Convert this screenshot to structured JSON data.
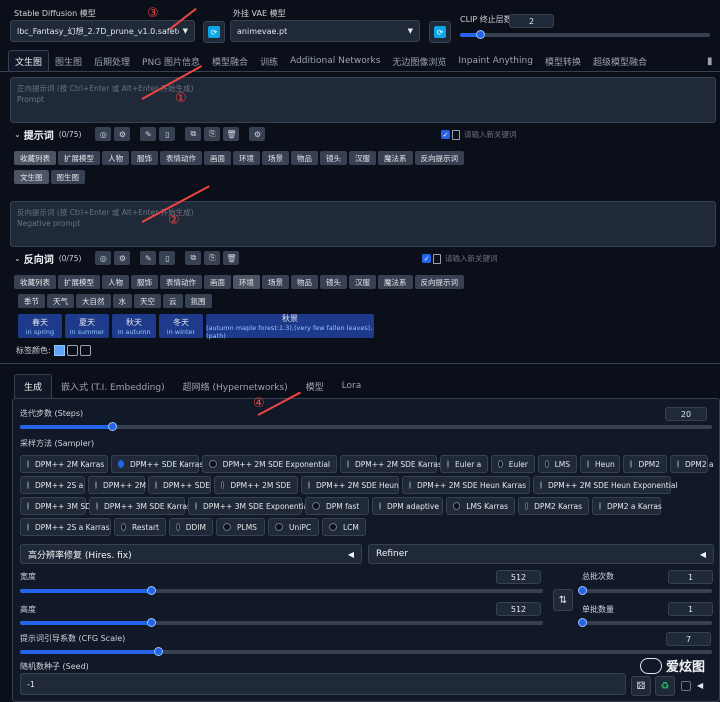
{
  "header": {
    "sd_model_label": "Stable Diffusion 模型",
    "sd_model_value": "lbc_Fantasy_幻想_2.7D_prune_v1.0.safetensors",
    "vae_label": "外挂 VAE 模型",
    "vae_value": "animevae.pt",
    "clip_label": "CLIP 终止层数",
    "clip_value": "2",
    "clip_fraction": 0.08
  },
  "main_tabs": [
    "文生图",
    "图生图",
    "后期处理",
    "PNG 图片信息",
    "模型融合",
    "训练",
    "Additional Networks",
    "无边图像浏览",
    "Inpaint Anything",
    "模型转换",
    "超级模型融合"
  ],
  "prompt": {
    "placeholder_cn": "正向提示词 (按 Ctrl+Enter 或 Alt+Enter 开始生成)",
    "placeholder_en": "Prompt",
    "title": "提示词",
    "count": "(0/75)",
    "new_keyword_placeholder": "请输入新关键词"
  },
  "prompt_cats": [
    "收藏列表",
    "扩展模型",
    "人物",
    "服饰",
    "表情动作",
    "画面",
    "环境",
    "场景",
    "物品",
    "镜头",
    "汉服",
    "魔法系",
    "反向提示词"
  ],
  "prompt_sub": [
    "文生图",
    "图生图"
  ],
  "neg": {
    "placeholder_cn": "反向提示词 (按 Ctrl+Enter 或 Alt+Enter 开始生成)",
    "placeholder_en": "Negative prompt",
    "title": "反向词",
    "count": "(0/75)",
    "new_keyword_placeholder": "请输入新关键词"
  },
  "neg_cats": [
    "收藏列表",
    "扩展模型",
    "人物",
    "服饰",
    "表情动作",
    "画面",
    "环境",
    "场景",
    "物品",
    "镜头",
    "汉服",
    "魔法系",
    "反向提示词"
  ],
  "env_sub": [
    "季节",
    "天气",
    "大自然",
    "水",
    "天空",
    "云",
    "氛围"
  ],
  "seasons": [
    {
      "t": "春天",
      "s": "in spring"
    },
    {
      "t": "夏天",
      "s": "in summer"
    },
    {
      "t": "秋天",
      "s": "in autumn"
    },
    {
      "t": "冬天",
      "s": "in winter"
    },
    {
      "t": "秋景",
      "s": "(autumn maple forest:1.3),(very few fallen leaves),(path)"
    }
  ],
  "tag_color_label": "标签颜色:",
  "gen_tabs": [
    "生成",
    "嵌入式 (T.I. Embedding)",
    "超网络 (Hypernetworks)",
    "模型",
    "Lora"
  ],
  "steps": {
    "label": "迭代步数 (Steps)",
    "value": "20",
    "fraction": 0.133
  },
  "sampler": {
    "label": "采样方法 (Sampler)",
    "rows": [
      [
        "DPM++ 2M Karras",
        "DPM++ SDE Karras",
        "DPM++ 2M SDE Exponential",
        "DPM++ 2M SDE Karras",
        "Euler a",
        "Euler",
        "LMS",
        "Heun",
        "DPM2",
        "DPM2 a"
      ],
      [
        "DPM++ 2S a",
        "DPM++ 2M",
        "DPM++ SDE",
        "DPM++ 2M SDE",
        "DPM++ 2M SDE Heun",
        "DPM++ 2M SDE Heun Karras",
        "DPM++ 2M SDE Heun Exponential"
      ],
      [
        "DPM++ 3M SDE",
        "DPM++ 3M SDE Karras",
        "DPM++ 3M SDE Exponential",
        "DPM fast",
        "DPM adaptive",
        "LMS Karras",
        "DPM2 Karras",
        "DPM2 a Karras"
      ],
      [
        "DPM++ 2S a Karras",
        "Restart",
        "DDIM",
        "PLMS",
        "UniPC",
        "LCM"
      ]
    ],
    "selected": "DPM++ SDE Karras"
  },
  "hires": {
    "label": "高分辨率修复 (Hires. fix)",
    "arrow": "◀"
  },
  "refiner": {
    "label": "Refiner",
    "arrow": "◀"
  },
  "width": {
    "label": "宽度",
    "value": "512",
    "fraction": 0.25
  },
  "height": {
    "label": "高度",
    "value": "512",
    "fraction": 0.25
  },
  "batch_count": {
    "label": "总批次数",
    "value": "1",
    "fraction": 0.0
  },
  "batch_size": {
    "label": "单批数量",
    "value": "1",
    "fraction": 0.0
  },
  "cfg": {
    "label": "提示词引导系数 (CFG Scale)",
    "value": "7",
    "fraction": 0.2
  },
  "seed": {
    "label": "随机数种子 (Seed)",
    "value": "-1"
  },
  "annotations": [
    "①",
    "②",
    "③",
    "④"
  ],
  "watermark": "爱炫图",
  "colors": {
    "bg": "#0b0f19",
    "accent": "#2563eb",
    "annot": "#ef4444"
  }
}
